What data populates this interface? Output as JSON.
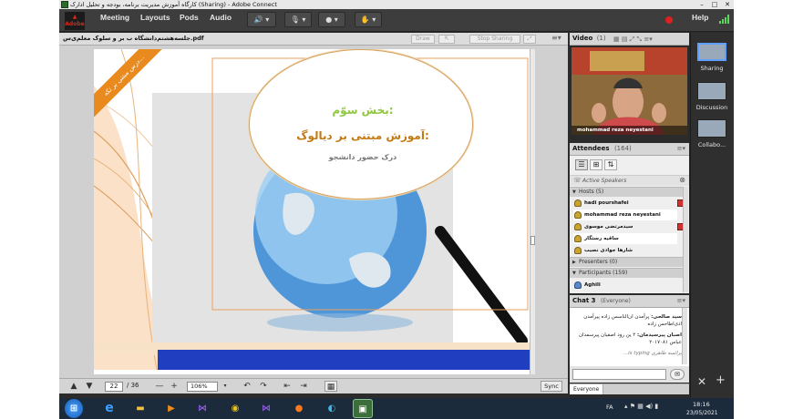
{
  "window": {
    "title": "کارگاه آموزش مدیریت برنامه، بودجه و تحلیل ادارک (Sharing) - Adobe Connect"
  },
  "menu": {
    "meeting": "Meeting",
    "layouts": "Layouts",
    "pods": "Pods",
    "audio": "Audio",
    "help": "Help"
  },
  "share_pod": {
    "file_name": "جلسه‌هشتم‌دانشگاه ب بر و سلوک معلم‌ی‌س.pdf",
    "draw_label": "Draw",
    "stop_sharing_label": "Stop Sharing",
    "page_current": "22",
    "page_total": "/ 36",
    "zoom": "106%",
    "sync_label": "Sync"
  },
  "slide": {
    "section_heading": "بخش سوّم:",
    "main_heading": "آموزش مبتنی بر دیالوگ:",
    "sub_heading": "درک حضور دانشجو",
    "corner_banner": "درس مبتنی بر تکه..."
  },
  "video_pod": {
    "title": "Video",
    "count": "(1)",
    "speaker_name": "mohammad reza neyestani"
  },
  "attendees_pod": {
    "title": "Attendees",
    "count": "(164)",
    "active_speakers": "Active Speakers",
    "hosts_label": "Hosts (5)",
    "hosts": [
      "hadi pourshafei",
      "mohammad reza neyestani",
      "سیدمرتضی موسوی",
      "ساقیه رستگار",
      "شارها جوادی نصیب"
    ],
    "presenters_label": "Presenters (0)",
    "participants_label": "Participants (159)",
    "participants": [
      "Aghili"
    ]
  },
  "chat_pod": {
    "title": "Chat 3",
    "scope": "(Everyone)",
    "messages": [
      {
        "sender": "سید صالحی:",
        "text": "پرآمدن ان‌الناسس زاده پیرآمدن ادی‌اطاحس زاده"
      },
      {
        "sender": "اصبان پیرسیدمان:",
        "text": "۲ ین رود اصفیان پیرسمدان عباس ۲۰۱۷۰۸۱"
      }
    ],
    "typing": "پرائسه طاهری is typing...",
    "recipient": "Everyone"
  },
  "layouts": [
    {
      "label": "Sharing"
    },
    {
      "label": "Discussion"
    },
    {
      "label": "Collabo..."
    }
  ],
  "taskbar": {
    "lang": "FA",
    "time": "18:16",
    "date": "23/05/2021"
  },
  "colors": {
    "accent_green": "#8dc63f",
    "title_orange": "#c47a12",
    "record_red": "#e02020"
  }
}
